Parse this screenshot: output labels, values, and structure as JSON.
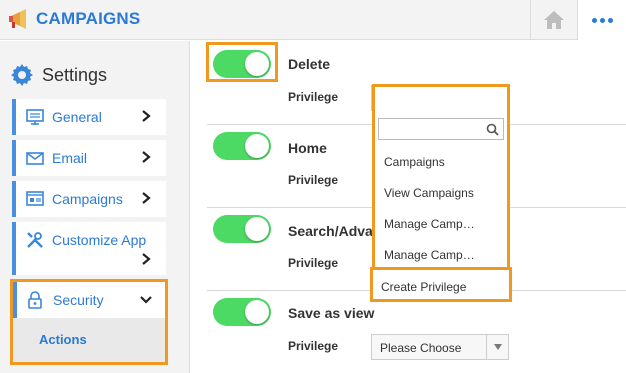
{
  "header": {
    "app_title": "CAMPAIGNS",
    "icons": {
      "logo": "megaphone-icon",
      "home": "home-icon",
      "more": "more-dots-icon"
    },
    "colors": {
      "brand": "#2a7ad6",
      "highlight": "#f0991f",
      "toggle_on": "#4cd964"
    }
  },
  "sidebar": {
    "title": "Settings",
    "items": [
      {
        "label": "General",
        "icon": "monitor-icon"
      },
      {
        "label": "Email",
        "icon": "envelope-icon"
      },
      {
        "label": "Campaigns",
        "icon": "campaign-list-icon"
      },
      {
        "label": "Customize App",
        "icon": "tools-icon"
      }
    ],
    "security": {
      "label": "Security",
      "icon": "lock-icon",
      "subitem": "Actions"
    }
  },
  "main": {
    "privilege_label": "Privilege",
    "rows": [
      {
        "title": "Delete",
        "enabled": true
      },
      {
        "title": "Home",
        "enabled": true
      },
      {
        "title": "Search/Adva",
        "enabled": true
      },
      {
        "title": "Save as view",
        "enabled": true
      }
    ],
    "select": {
      "placeholder": "Please Choose"
    },
    "dropdown": {
      "options": [
        "Campaigns",
        "View Campaigns",
        "Manage Camp…",
        "Manage Camp…"
      ],
      "create_label": "Create Privilege"
    }
  }
}
